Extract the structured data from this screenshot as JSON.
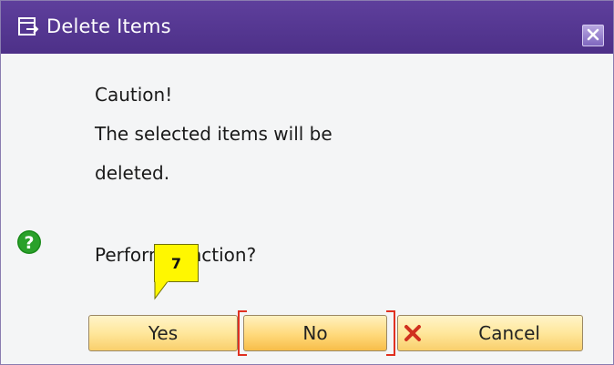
{
  "dialog": {
    "title": "Delete Items",
    "title_icon": "dialog-window-icon",
    "close_icon": "close-icon"
  },
  "message": {
    "line1": "Caution!",
    "line2": "The selected items will be",
    "line3": "deleted."
  },
  "prompt": {
    "text": "Perform function?",
    "icon": "question-icon",
    "icon_color": "#1a8a1a"
  },
  "tooltip": {
    "label": "7",
    "color": "#fff700"
  },
  "buttons": {
    "yes_label": "Yes",
    "no_label": "No",
    "cancel_label": "Cancel",
    "cancel_icon": "cancel-x-icon"
  },
  "colors": {
    "titlebar": "#5e3f9c",
    "button_fill": "#ffe79b",
    "focus_outline": "#e03020"
  }
}
